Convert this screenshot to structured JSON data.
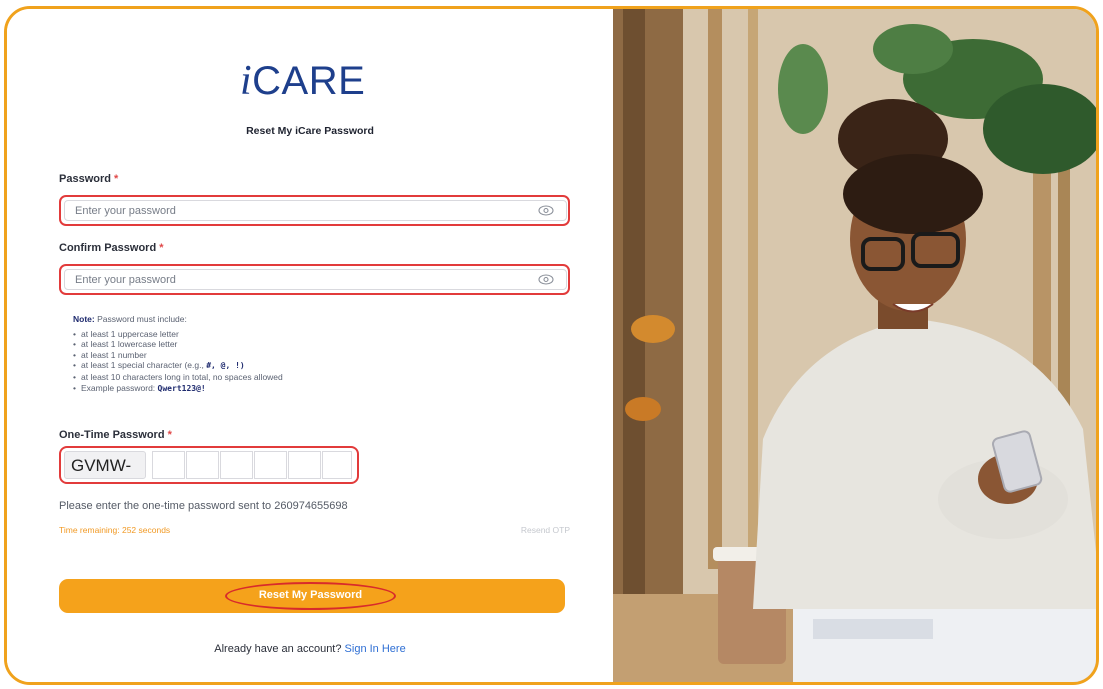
{
  "logo": {
    "prefix": "i",
    "suffix": "CARE"
  },
  "page_title": "Reset My iCare Password",
  "password": {
    "label": "Password",
    "required_mark": "*",
    "placeholder": "Enter your password"
  },
  "confirm_password": {
    "label": "Confirm Password",
    "required_mark": "*",
    "placeholder": "Enter your password"
  },
  "note": {
    "heading": "Note:",
    "intro": "Password must include:",
    "rules": [
      "at least 1 uppercase letter",
      "at least 1 lowercase letter",
      "at least 1 number",
      "at least 1 special character (e.g.,",
      "at least 10 characters long in total, no spaces allowed",
      "Example password:"
    ],
    "special_chars": "#, @, !)",
    "example_password": "Qwert123@!"
  },
  "otp": {
    "label": "One-Time Password",
    "required_mark": "*",
    "prefix": "GVMW-",
    "info": "Please enter the one-time password sent to 260974655698",
    "timer": "Time remaining: 252 seconds",
    "resend": "Resend OTP"
  },
  "submit_label": "Reset My Password",
  "signin": {
    "prompt": "Already have an account?",
    "link": "Sign In Here"
  },
  "colors": {
    "accent": "#f5a21b",
    "brand": "#1e3f8c",
    "highlight": "#e23b3b",
    "link": "#2f6fd4"
  }
}
